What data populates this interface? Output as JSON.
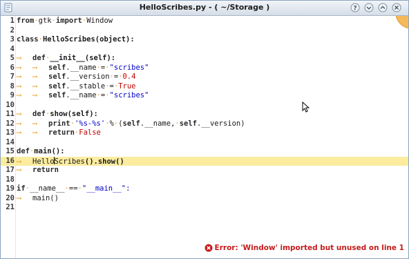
{
  "window": {
    "title": "HelloScribes.py - ( ~/Storage )"
  },
  "colors": {
    "current_line": "#fbeca0",
    "whitespace_marker": "#e89a1f",
    "string": "#0000c8",
    "number": "#c00000",
    "error": "#c41a1a"
  },
  "editor": {
    "current_line": 16,
    "lines": [
      {
        "num": "1",
        "tokens": [
          [
            "kw",
            "from"
          ],
          [
            "ws",
            "·"
          ],
          [
            "id",
            "gtk"
          ],
          [
            "ws",
            "·"
          ],
          [
            "kw",
            "import"
          ],
          [
            "ws",
            "·"
          ],
          [
            "id",
            "Window"
          ]
        ]
      },
      {
        "num": "2",
        "tokens": []
      },
      {
        "num": "3",
        "tokens": [
          [
            "kw",
            "class"
          ],
          [
            "ws",
            "·"
          ],
          [
            "fn",
            "HelloScribes(object):"
          ]
        ]
      },
      {
        "num": "4",
        "tokens": []
      },
      {
        "num": "5",
        "tokens": [
          [
            "tab",
            "⟶"
          ],
          [
            "kw",
            "def"
          ],
          [
            "ws",
            "·"
          ],
          [
            "fn",
            "__init__(self):"
          ]
        ]
      },
      {
        "num": "6",
        "tokens": [
          [
            "tab",
            "⟶"
          ],
          [
            "tab",
            "⟶"
          ],
          [
            "self",
            "self"
          ],
          [
            "id",
            "."
          ],
          [
            "id",
            "__name"
          ],
          [
            "ws",
            "·"
          ],
          [
            "op",
            "="
          ],
          [
            "ws",
            "·"
          ],
          [
            "str",
            "\"scribes\""
          ]
        ]
      },
      {
        "num": "7",
        "tokens": [
          [
            "tab",
            "⟶"
          ],
          [
            "tab",
            "⟶"
          ],
          [
            "self",
            "self"
          ],
          [
            "id",
            "."
          ],
          [
            "id",
            "__version"
          ],
          [
            "ws",
            "·"
          ],
          [
            "op",
            "="
          ],
          [
            "ws",
            "·"
          ],
          [
            "num",
            "0.4"
          ]
        ]
      },
      {
        "num": "8",
        "tokens": [
          [
            "tab",
            "⟶"
          ],
          [
            "tab",
            "⟶"
          ],
          [
            "self",
            "self"
          ],
          [
            "id",
            "."
          ],
          [
            "id",
            "__stable"
          ],
          [
            "ws",
            "·"
          ],
          [
            "op",
            "="
          ],
          [
            "ws",
            "·"
          ],
          [
            "const",
            "True"
          ]
        ]
      },
      {
        "num": "9",
        "tokens": [
          [
            "tab",
            "⟶"
          ],
          [
            "tab",
            "⟶"
          ],
          [
            "self",
            "self"
          ],
          [
            "id",
            "."
          ],
          [
            "id",
            "__name"
          ],
          [
            "ws",
            "·"
          ],
          [
            "op",
            "="
          ],
          [
            "ws",
            "·"
          ],
          [
            "str",
            "\"scribes\""
          ]
        ]
      },
      {
        "num": "10",
        "tokens": []
      },
      {
        "num": "11",
        "tokens": [
          [
            "tab",
            "⟶"
          ],
          [
            "kw",
            "def"
          ],
          [
            "ws",
            "·"
          ],
          [
            "fn",
            "show(self):"
          ]
        ]
      },
      {
        "num": "12",
        "tokens": [
          [
            "tab",
            "⟶"
          ],
          [
            "tab",
            "⟶"
          ],
          [
            "kw",
            "print"
          ],
          [
            "ws",
            "·"
          ],
          [
            "str",
            "'%s-%s'"
          ],
          [
            "ws",
            "·"
          ],
          [
            "op",
            "%"
          ],
          [
            "ws",
            "·"
          ],
          [
            "id",
            "("
          ],
          [
            "self",
            "self"
          ],
          [
            "id",
            ".__name,"
          ],
          [
            "ws",
            "·"
          ],
          [
            "self",
            "self"
          ],
          [
            "id",
            ".__version)"
          ]
        ]
      },
      {
        "num": "13",
        "tokens": [
          [
            "tab",
            "⟶"
          ],
          [
            "tab",
            "⟶"
          ],
          [
            "kw",
            "return"
          ],
          [
            "ws",
            "·"
          ],
          [
            "const",
            "False"
          ]
        ]
      },
      {
        "num": "14",
        "tokens": []
      },
      {
        "num": "15",
        "tokens": [
          [
            "kw",
            "def"
          ],
          [
            "ws",
            "·"
          ],
          [
            "fn",
            "main():"
          ]
        ]
      },
      {
        "num": "16",
        "tokens": [
          [
            "tab",
            "⟶"
          ],
          [
            "id",
            "Hello"
          ],
          [
            "caret",
            ""
          ],
          [
            "id",
            "Scribes"
          ],
          [
            "fn",
            "().show()"
          ]
        ]
      },
      {
        "num": "17",
        "tokens": [
          [
            "tab",
            "⟶"
          ],
          [
            "kw",
            "return"
          ]
        ]
      },
      {
        "num": "18",
        "tokens": []
      },
      {
        "num": "19",
        "tokens": [
          [
            "kw",
            "if"
          ],
          [
            "ws",
            "·"
          ],
          [
            "id",
            "__name__"
          ],
          [
            "ws",
            "·"
          ],
          [
            "op",
            "=="
          ],
          [
            "ws",
            "·"
          ],
          [
            "str",
            "\"__main__\":"
          ]
        ]
      },
      {
        "num": "20",
        "tokens": [
          [
            "tab",
            "⟶"
          ],
          [
            "id",
            "main()"
          ]
        ]
      },
      {
        "num": "21",
        "tokens": []
      }
    ]
  },
  "status": {
    "error_icon": "error-circle-icon",
    "message": "Error: 'Window' imported but unused on line 1"
  },
  "icons": {
    "app": "document-icon",
    "help": "help-icon",
    "minimize": "minimize-icon",
    "maximize": "maximize-icon",
    "close": "close-icon"
  }
}
